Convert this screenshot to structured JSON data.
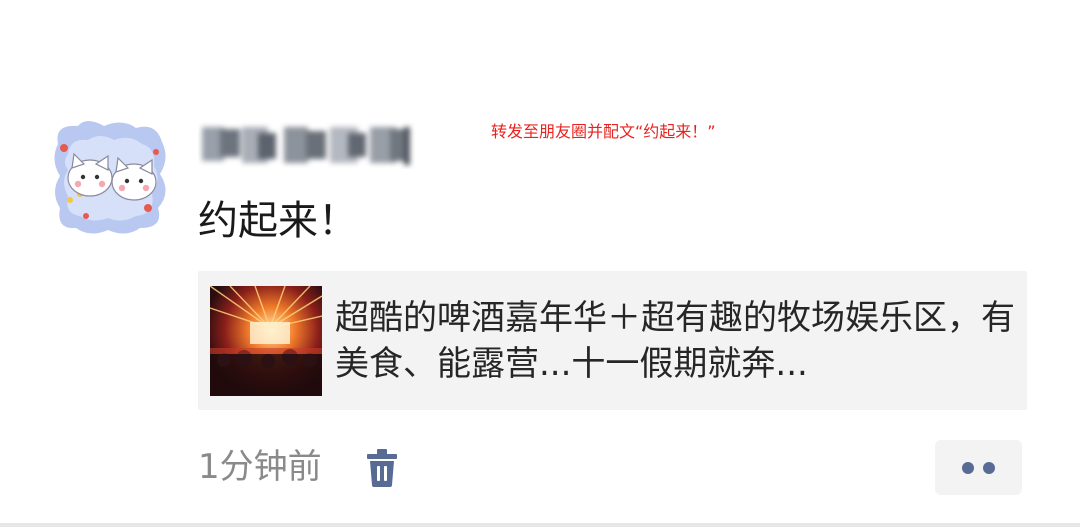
{
  "annotation": {
    "text": "转发至朋友圈并配文“约起来！”",
    "color": "#e8231f"
  },
  "post": {
    "author_name_blurred": true,
    "text": "约起来！"
  },
  "link_card": {
    "title": "超酷的啤酒嘉年华＋超有趣的牧场娱乐区，有美食、能露营...十一假期就奔..."
  },
  "footer": {
    "timestamp": "1分钟前",
    "delete_icon": "trash-icon",
    "more_icon": "more-dots-icon",
    "link_color": "#576b95"
  }
}
